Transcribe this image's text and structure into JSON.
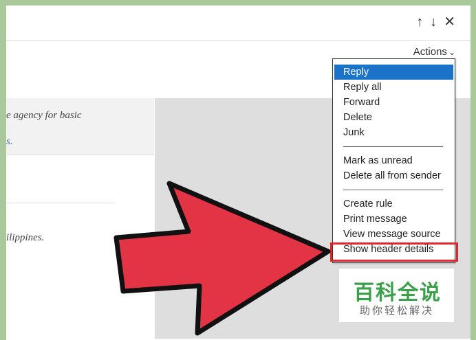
{
  "toolbar": {
    "up_icon": "↑",
    "down_icon": "↓",
    "close_icon": "✕"
  },
  "actions": {
    "label": "Actions",
    "chevron": "⌄"
  },
  "message": {
    "line1": "e agency for basic",
    "line2": "s.",
    "line3": "ilippines."
  },
  "menu": {
    "items": [
      {
        "label": "Reply"
      },
      {
        "label": "Reply all"
      },
      {
        "label": "Forward"
      },
      {
        "label": "Delete"
      },
      {
        "label": "Junk"
      },
      {
        "label": "Mark as unread"
      },
      {
        "label": "Delete all from sender"
      },
      {
        "label": "Create rule"
      },
      {
        "label": "Print message"
      },
      {
        "label": "View message source"
      },
      {
        "label": "Show header details"
      }
    ]
  },
  "watermark": {
    "main": "百科全说",
    "sub": "助你轻松解决"
  },
  "colors": {
    "selection": "#1a73c9",
    "highlight": "#e2262d",
    "arrow": "#e23444",
    "watermark_green": "#3aa04a",
    "background_green": "#a9c99a"
  }
}
